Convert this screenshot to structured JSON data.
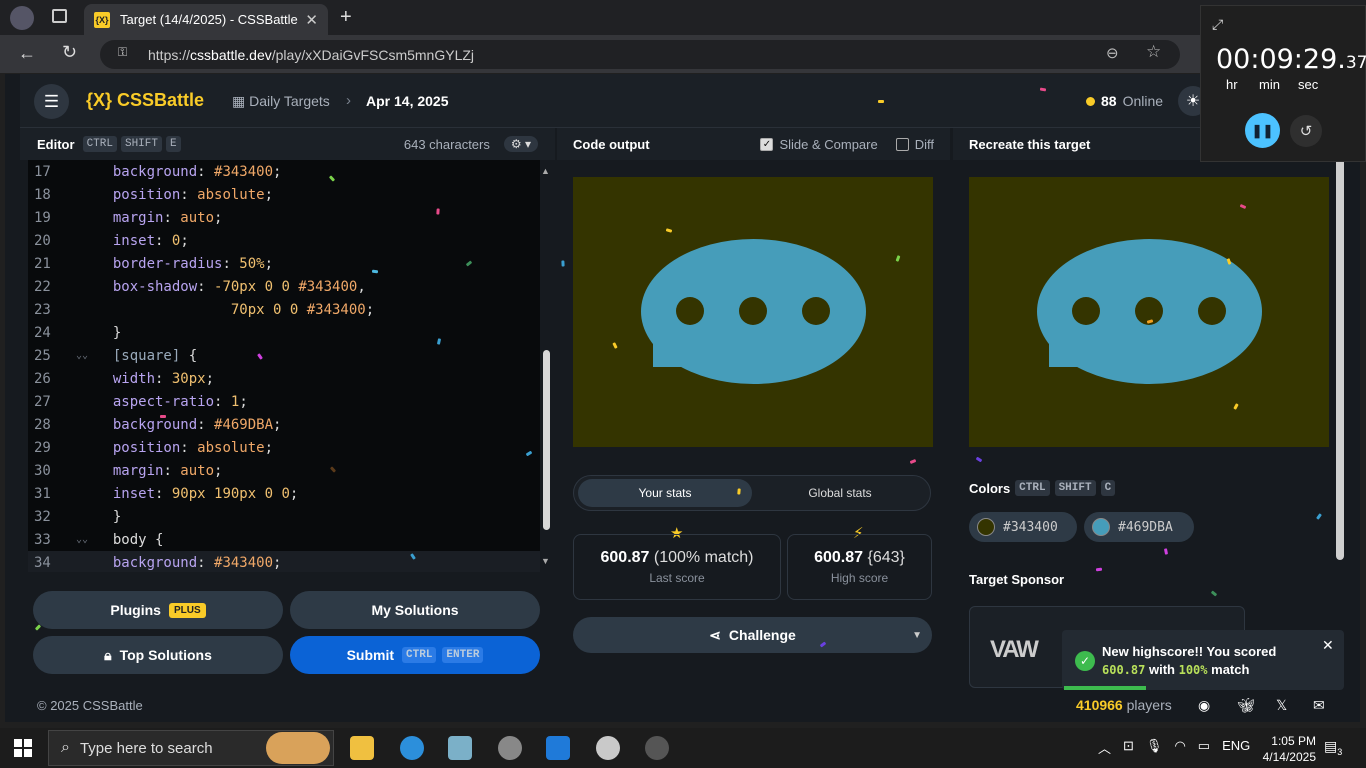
{
  "browser": {
    "tab_title": "Target (14/4/2025) - CSSBattle",
    "tab_favicon": "{X}",
    "url_prefix": "https://",
    "url_host": "cssbattle.dev",
    "url_path": "/play/xXDaiGvFSCsm5mnGYLZj"
  },
  "nav": {
    "logo": "{X} CSSBattle",
    "crumb_section": "Daily Targets",
    "crumb_date": "Apr 14, 2025",
    "online_count": "88",
    "online_label": "Online"
  },
  "editor": {
    "title": "Editor",
    "shortcut": [
      "CTRL",
      "SHIFT",
      "E"
    ],
    "char_count": "643 characters"
  },
  "code_lines": [
    {
      "n": "17",
      "fold": "",
      "html": "<span class='txt'>    </span><span class='prop'>background</span><span class='txt'>: </span><span class='val'>#343400</span><span class='txt'>;</span>"
    },
    {
      "n": "18",
      "fold": "",
      "html": "<span class='txt'>    </span><span class='prop'>position</span><span class='txt'>: </span><span class='val'>absolute</span><span class='txt'>;</span>"
    },
    {
      "n": "19",
      "fold": "",
      "html": "<span class='txt'>    </span><span class='prop'>margin</span><span class='txt'>: </span><span class='val'>auto</span><span class='txt'>;</span>"
    },
    {
      "n": "20",
      "fold": "",
      "html": "<span class='txt'>    </span><span class='prop'>inset</span><span class='txt'>: </span><span class='num'>0</span><span class='txt'>;</span>"
    },
    {
      "n": "21",
      "fold": "",
      "html": "<span class='txt'>    </span><span class='prop'>border-radius</span><span class='txt'>: </span><span class='num'>50%</span><span class='txt'>;</span>"
    },
    {
      "n": "22",
      "fold": "",
      "html": "<span class='txt'>    </span><span class='prop'>box-shadow</span><span class='txt'>: </span><span class='num'>-70px 0 0 </span><span class='val'>#343400</span><span class='txt'>,</span>"
    },
    {
      "n": "23",
      "fold": "",
      "html": "<span class='txt'>                </span><span class='num'>70px 0 0 </span><span class='val'>#343400</span><span class='txt'>;</span>"
    },
    {
      "n": "24",
      "fold": "",
      "html": "<span class='txt'>  }</span>"
    },
    {
      "n": "25",
      "fold": "⌄⌄",
      "html": "<span class='sel'>  [square]</span><span class='txt'> {</span>"
    },
    {
      "n": "26",
      "fold": "",
      "html": "<span class='txt'>    </span><span class='prop'>width</span><span class='txt'>: </span><span class='num'>30px</span><span class='txt'>;</span>"
    },
    {
      "n": "27",
      "fold": "",
      "html": "<span class='txt'>    </span><span class='prop'>aspect-ratio</span><span class='txt'>: </span><span class='num'>1</span><span class='txt'>;</span>"
    },
    {
      "n": "28",
      "fold": "",
      "html": "<span class='txt'>    </span><span class='prop'>background</span><span class='txt'>: </span><span class='val'>#469DBA</span><span class='txt'>;</span>"
    },
    {
      "n": "29",
      "fold": "",
      "html": "<span class='txt'>    </span><span class='prop'>position</span><span class='txt'>: </span><span class='val'>absolute</span><span class='txt'>;</span>"
    },
    {
      "n": "30",
      "fold": "",
      "html": "<span class='txt'>    </span><span class='prop'>margin</span><span class='txt'>: </span><span class='val'>auto</span><span class='txt'>;</span>"
    },
    {
      "n": "31",
      "fold": "",
      "html": "<span class='txt'>    </span><span class='prop'>inset</span><span class='txt'>: </span><span class='num'>90px 190px 0 0</span><span class='txt'>;</span>"
    },
    {
      "n": "32",
      "fold": "",
      "html": "<span class='txt'>  }</span>"
    },
    {
      "n": "33",
      "fold": "⌄⌄",
      "html": "<span class='txt'>  body {</span>"
    },
    {
      "n": "34",
      "fold": "",
      "html": "<span class='txt'>    </span><span class='prop'>background</span><span class='txt'>: </span><span class='val'>#343400</span><span class='txt'>;</span>"
    }
  ],
  "buttons": {
    "plugins": "Plugins",
    "plus_badge": "PLUS",
    "my_solutions": "My Solutions",
    "top_solutions": "Top Solutions",
    "submit": "Submit",
    "submit_shortcut": [
      "CTRL",
      "ENTER"
    ]
  },
  "output": {
    "title": "Code output",
    "slide_compare": "Slide & Compare",
    "diff": "Diff"
  },
  "stats": {
    "tab_your": "Your stats",
    "tab_global": "Global stats",
    "last_score": "600.87",
    "last_match": "(100% match)",
    "last_label": "Last score",
    "high_score": "600.87",
    "high_chars": "{643}",
    "high_label": "High score",
    "challenge": "Challenge"
  },
  "target": {
    "title": "Recreate this target",
    "colors_label": "Colors",
    "colors_shortcut": [
      "CTRL",
      "SHIFT",
      "C"
    ],
    "color1": "#343400",
    "color2": "#469DBA",
    "sponsor_label": "Target Sponsor",
    "sponsor_logo": "VAW"
  },
  "toast": {
    "line1": "New highscore!! You scored",
    "score": "600.87",
    "with": "with",
    "match": "100%",
    "match_suffix": "match"
  },
  "footer": {
    "copyright": "© 2025 CSSBattle",
    "players_count": "410966",
    "players_label": "players"
  },
  "timer": {
    "time": "00:09:29.",
    "centis": "37",
    "hr": "hr",
    "min": "min",
    "sec": "sec"
  },
  "taskbar": {
    "search_placeholder": "Type here to search",
    "lang": "ENG",
    "time": "1:05 PM",
    "date": "4/14/2025",
    "notif_count": "3"
  }
}
